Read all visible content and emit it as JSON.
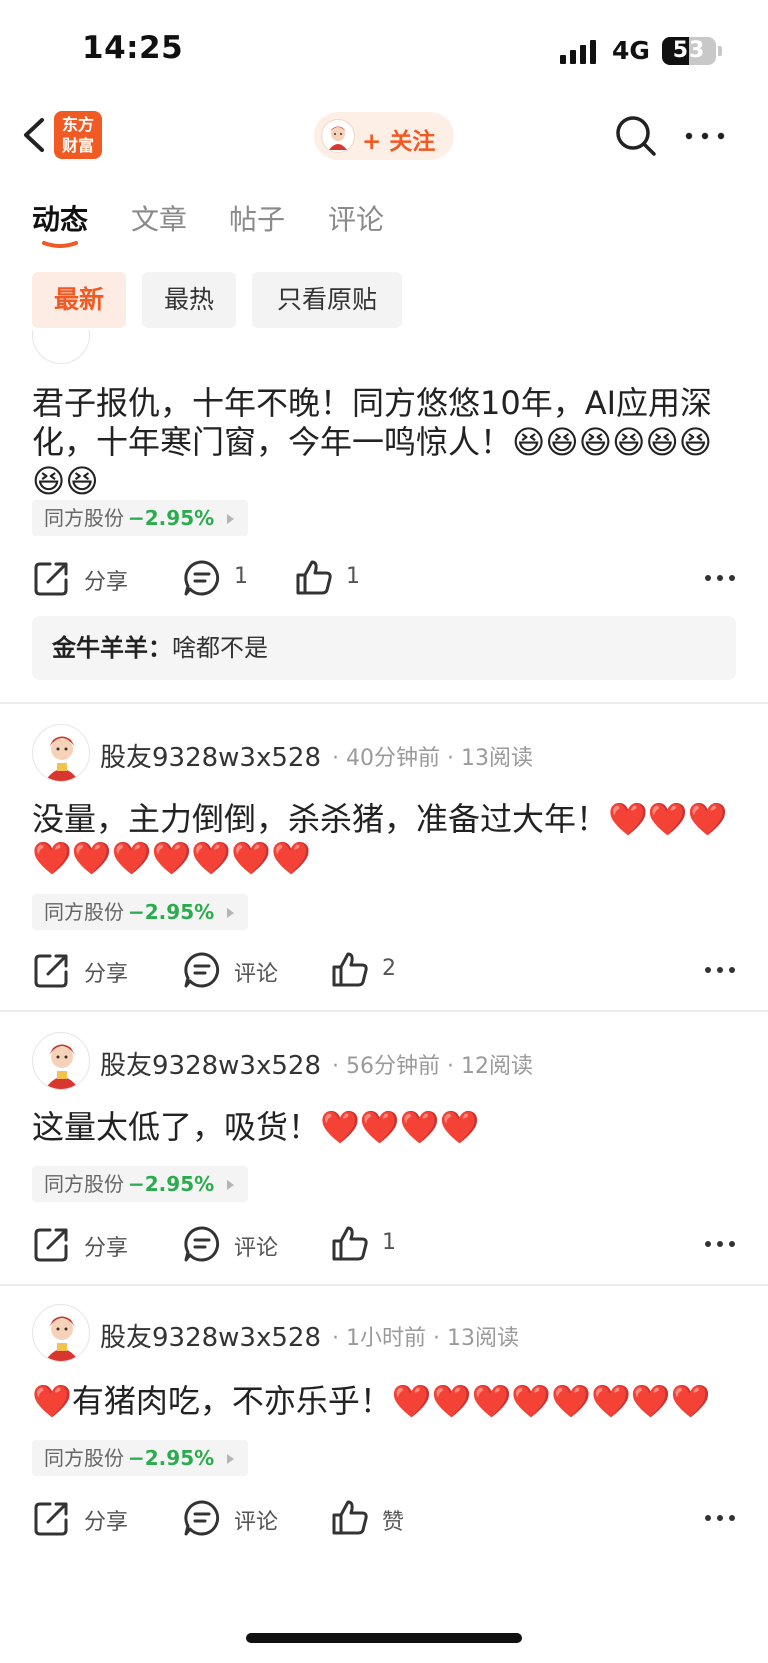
{
  "status_bar": {
    "time": "14:25",
    "network": "4G",
    "battery": "53",
    "battery_fraction": 0.5
  },
  "nav": {
    "logo_text": "东方财富",
    "follow_label": "+ 关注"
  },
  "tabs": [
    {
      "label": "动态",
      "active": true
    },
    {
      "label": "文章",
      "active": false
    },
    {
      "label": "帖子",
      "active": false
    },
    {
      "label": "评论",
      "active": false
    }
  ],
  "filters": [
    {
      "label": "最新",
      "active": true
    },
    {
      "label": "最热",
      "active": false
    },
    {
      "label": "只看原贴",
      "active": false
    }
  ],
  "colors": {
    "accent": "#f15a22",
    "down": "#2cab4f"
  },
  "posts": [
    {
      "author": "",
      "content": "君子报仇，十年不晚！同方悠悠10年，AI应用深化，十年寒门窗，今年一鸣惊人！😆😆😆😆😆😆😆😆",
      "stock_name": "同方股份",
      "stock_change": "−2.95%",
      "share_label": "分享",
      "comment_label": "1",
      "like_label": "1",
      "reply": {
        "author": "金牛羊羊：",
        "text": "啥都不是"
      }
    },
    {
      "author": "股友9328w3x528",
      "time": "40分钟前",
      "reads": "13阅读",
      "content": "没量，主力倒倒，杀杀猪，准备过大年！❤️❤️❤️❤️❤️❤️❤️❤️❤️❤️",
      "stock_name": "同方股份",
      "stock_change": "−2.95%",
      "share_label": "分享",
      "comment_label": "评论",
      "like_label": "2"
    },
    {
      "author": "股友9328w3x528",
      "time": "56分钟前",
      "reads": "12阅读",
      "content": "这量太低了，吸货！❤️❤️❤️❤️",
      "stock_name": "同方股份",
      "stock_change": "−2.95%",
      "share_label": "分享",
      "comment_label": "评论",
      "like_label": "1"
    },
    {
      "author": "股友9328w3x528",
      "time": "1小时前",
      "reads": "13阅读",
      "content": "❤️有猪肉吃，不亦乐乎！❤️❤️❤️❤️❤️❤️❤️❤️",
      "stock_name": "同方股份",
      "stock_change": "−2.95%",
      "share_label": "分享",
      "comment_label": "评论",
      "like_label": "赞"
    }
  ]
}
